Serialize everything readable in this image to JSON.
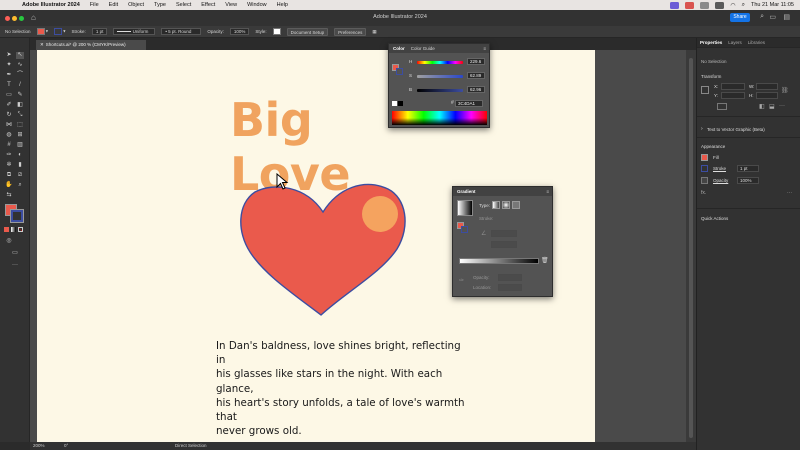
{
  "menubar": {
    "app": "Adobe Illustrator 2024",
    "items": [
      "File",
      "Edit",
      "Object",
      "Type",
      "Select",
      "Effect",
      "View",
      "Window",
      "Help"
    ],
    "clock": "Thu 21 Mar  11:05"
  },
  "window": {
    "title": "Adobe Illustrator 2024",
    "share": "Share"
  },
  "controlbar": {
    "selection": "No Selection",
    "stroke_label": "Stroke:",
    "stroke_value": "1 pt",
    "uniform": "Uniform",
    "brush": "5 pt. Round",
    "opacity_label": "Opacity:",
    "opacity_value": "100%",
    "style_label": "Style:",
    "document_setup": "Document Setup",
    "preferences": "Preferences"
  },
  "document": {
    "tab": "Shortcuts.ai* @ 200 % (CMYK/Preview)"
  },
  "artwork": {
    "title": "Big Love",
    "poem_lines": [
      "In Dan's baldness, love shines bright, reflecting in",
      "his glasses like stars in the night. With each glance,",
      "his heart's story unfolds, a tale of love's warmth that",
      "never grows old."
    ]
  },
  "status": {
    "zoom": "200%",
    "rotation": "0°",
    "tool": "Direct Selection"
  },
  "color_panel": {
    "tabs": [
      "Color",
      "Color Guide"
    ],
    "h_label": "H",
    "h_value": "229.6",
    "s_label": "S",
    "s_value": "62.89",
    "b_label": "B",
    "b_value": "62.96",
    "hex": "3C4DA1"
  },
  "gradient_panel": {
    "title": "Gradient",
    "type_label": "Type:",
    "stroke_label": "Stroke:",
    "opacity_label": "Opacity:",
    "location_label": "Location:"
  },
  "right_panel": {
    "tabs": [
      "Properties",
      "Layers",
      "Libraries"
    ],
    "no_selection": "No Selection",
    "transform": "Transform",
    "x": "X:",
    "y": "Y:",
    "w": "W:",
    "h": "H:",
    "text_to_vector": "Text to Vector Graphic (Beta)",
    "appearance": "Appearance",
    "fill": "Fill",
    "stroke": "Stroke",
    "stroke_value": "1 pt",
    "opacity": "Opacity",
    "opacity_value": "100%",
    "quick_actions": "Quick Actions"
  },
  "colors": {
    "heart_fill": "#ea5a4c",
    "heart_stroke": "#3c4da1",
    "circle_fill": "#f5a35f",
    "title_color": "#f0a35f",
    "artboard": "#fdf8e6",
    "accent": "#1473e6"
  }
}
